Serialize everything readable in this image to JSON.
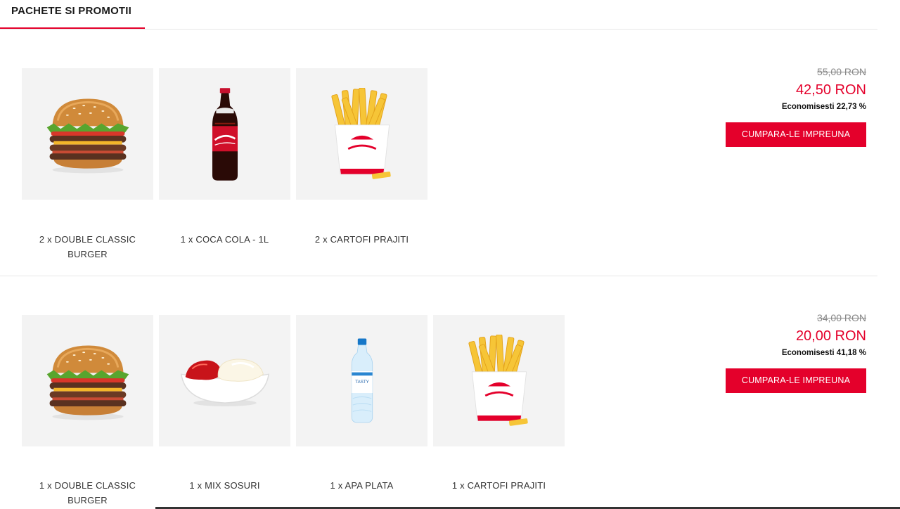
{
  "header": {
    "tab_label": "PACHETE SI PROMOTII"
  },
  "bundles": [
    {
      "items": [
        {
          "label": "2 x DOUBLE CLASSIC BURGER",
          "icon": "burger-image"
        },
        {
          "label": "1 x COCA COLA - 1L",
          "icon": "cola-bottle-image"
        },
        {
          "label": "2 x CARTOFI PRAJITI",
          "icon": "fries-image"
        }
      ],
      "old_price": "55,00 RON",
      "new_price": "42,50 RON",
      "savings": "Economisesti 22,73 %",
      "button_label": "CUMPARA-LE IMPREUNA"
    },
    {
      "items": [
        {
          "label": "1 x DOUBLE CLASSIC BURGER",
          "icon": "burger-image"
        },
        {
          "label": "1 x MIX SOSURI",
          "icon": "sauce-bowl-image"
        },
        {
          "label": "1 x APA PLATA",
          "icon": "water-bottle-image"
        },
        {
          "label": "1 x CARTOFI PRAJITI",
          "icon": "fries-image"
        }
      ],
      "old_price": "34,00 RON",
      "new_price": "20,00 RON",
      "savings": "Economisesti 41,18 %",
      "button_label": "CUMPARA-LE IMPREUNA"
    }
  ],
  "colors": {
    "accent": "#e4002b",
    "thumb_bg": "#f3f3f3",
    "divider": "#e6e6e6"
  }
}
